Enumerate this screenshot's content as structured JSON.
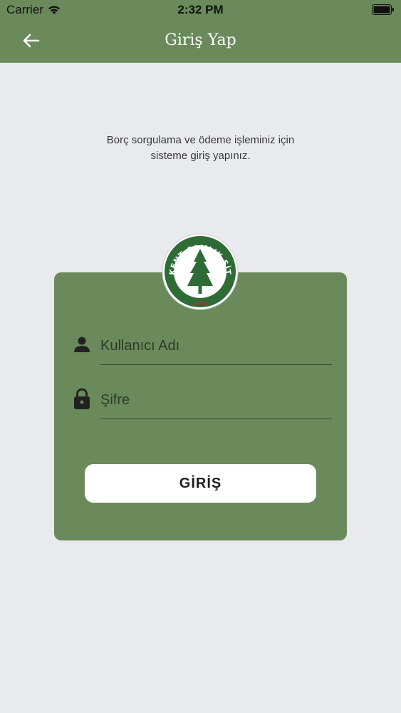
{
  "status_bar": {
    "carrier": "Carrier",
    "time": "2:32 PM"
  },
  "nav": {
    "title": "Giriş Yap",
    "back_icon": "arrow-left-icon"
  },
  "intro": {
    "line1": "Borç sorgulama ve ödeme işleminiz için",
    "line2": "sisteme giriş yapınız."
  },
  "logo": {
    "ring_text": "BİLKENT ÇAMLIK SİTESİ",
    "year": "1994"
  },
  "form": {
    "username_placeholder": "Kullanıcı Adı",
    "password_placeholder": "Şifre",
    "submit_label": "GİRİŞ"
  },
  "colors": {
    "primary": "#6a8a5b",
    "background": "#e9eaed",
    "button": "#ffffff"
  }
}
